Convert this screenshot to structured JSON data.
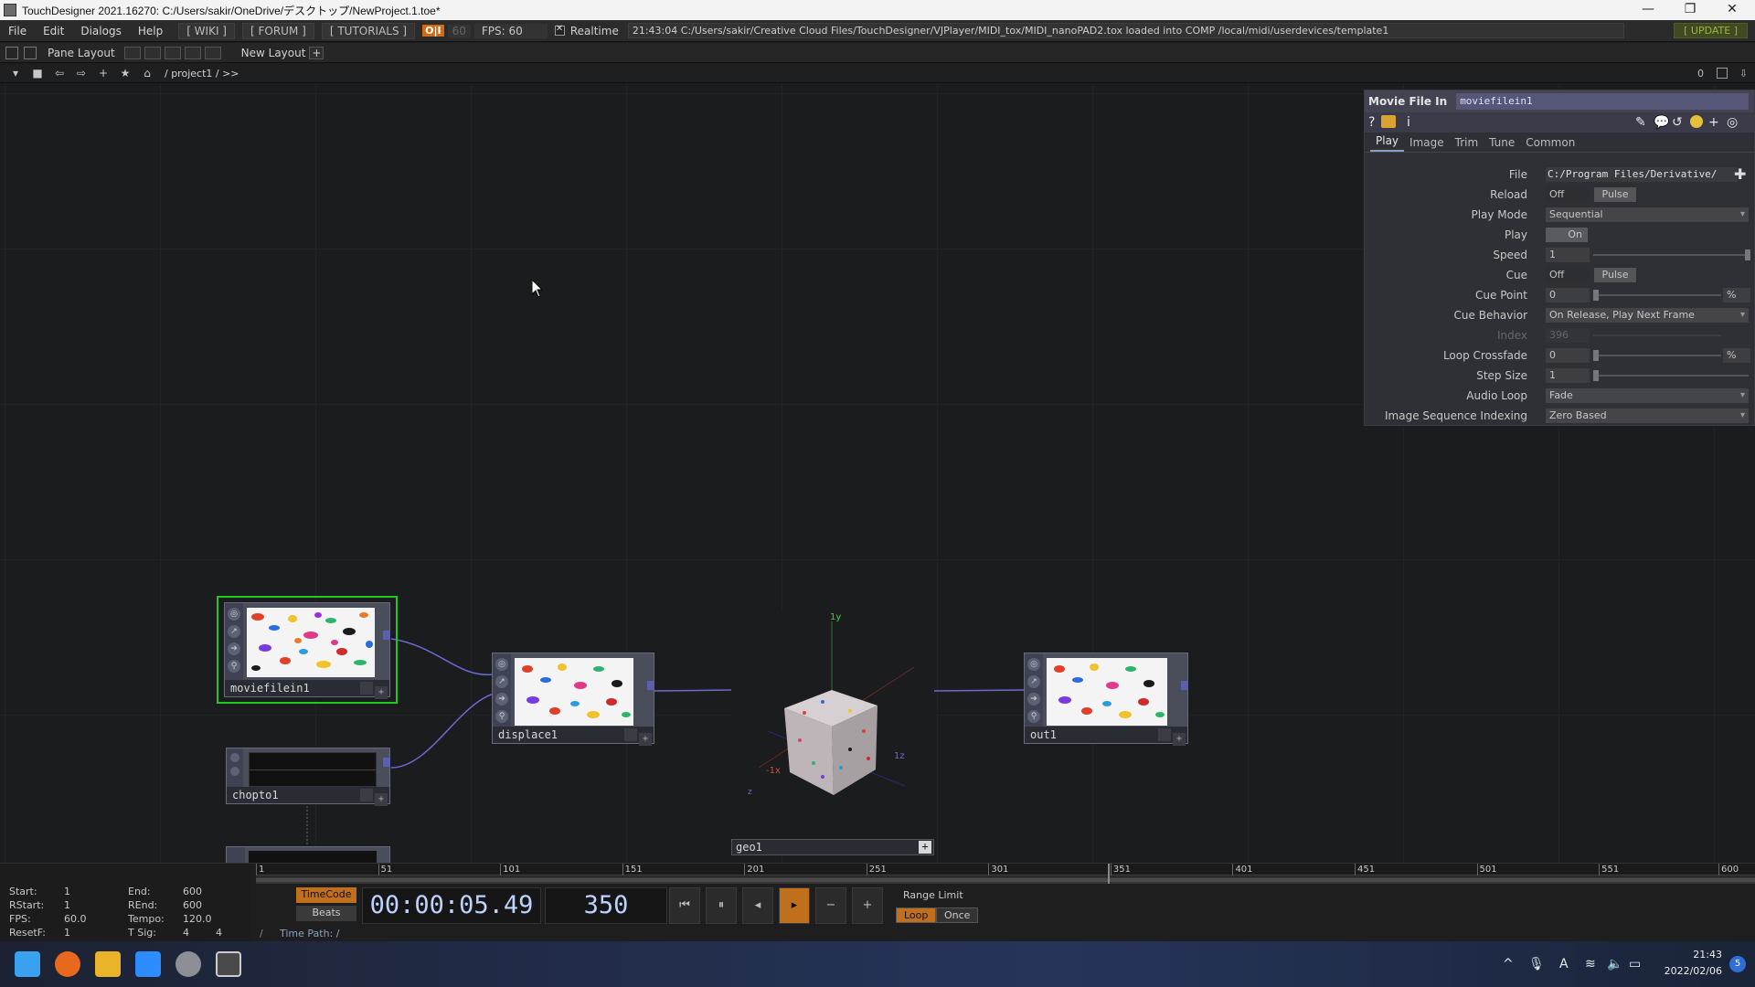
{
  "window": {
    "title": "TouchDesigner 2021.16270: C:/Users/sakir/OneDrive/デスクトップ/NewProject.1.toe*",
    "controls": {
      "minimize": "—",
      "maximize": "❐",
      "close": "✕"
    }
  },
  "menubar": {
    "items": [
      "File",
      "Edit",
      "Dialogs",
      "Help"
    ],
    "links": [
      "[ WIKI ]",
      "[ FORUM ]",
      "[ TUTORIALS ]"
    ],
    "perf_badge": "O|I",
    "fps_target": "60",
    "fps_label": "FPS:  60",
    "realtime_label": "Realtime",
    "status": "21:43:04 C:/Users/sakir/Creative Cloud Files/TouchDesigner/VJPlayer/MIDI_tox/MIDI_nanoPAD2.tox loaded into COMP /local/midi/userdevices/template1",
    "update_label": "[ UPDATE ]"
  },
  "panebar": {
    "pane_layout_label": "Pane Layout",
    "new_layout_label": "New Layout",
    "add_label": "+"
  },
  "pathbar": {
    "path": "/ project1 / >>",
    "right_value": "0"
  },
  "nodes": {
    "moviefilein": {
      "name": "moviefilein1",
      "selected": true
    },
    "displace": {
      "name": "displace1"
    },
    "geo": {
      "name": "geo1",
      "add_label": "+"
    },
    "out": {
      "name": "out1"
    },
    "chopto": {
      "name": "chopto1"
    },
    "axis_labels": {
      "y": "1y",
      "negx": "-1x",
      "z": "1z",
      "small": "z"
    }
  },
  "params": {
    "op_type": "Movie File In",
    "op_name": "moviefilein1",
    "tabs": [
      "Play",
      "Image",
      "Trim",
      "Tune",
      "Common"
    ],
    "active_tab": "Play",
    "rows": {
      "file": {
        "label": "File",
        "value": "C:/Program Files/Derivative/"
      },
      "reload": {
        "label": "Reload",
        "value": "Off",
        "pulse": "Pulse"
      },
      "play_mode": {
        "label": "Play Mode",
        "value": "Sequential"
      },
      "play": {
        "label": "Play",
        "value": "On"
      },
      "speed": {
        "label": "Speed",
        "value": "1"
      },
      "cue": {
        "label": "Cue",
        "value": "Off",
        "pulse": "Pulse"
      },
      "cue_point": {
        "label": "Cue Point",
        "value": "0",
        "unit": "%"
      },
      "cue_behavior": {
        "label": "Cue Behavior",
        "value": "On Release, Play Next Frame"
      },
      "index": {
        "label": "Index",
        "value": "396"
      },
      "loop_crossfade": {
        "label": "Loop Crossfade",
        "value": "0",
        "unit": "%"
      },
      "step_size": {
        "label": "Step Size",
        "value": "1"
      },
      "audio_loop": {
        "label": "Audio Loop",
        "value": "Fade"
      },
      "image_seq": {
        "label": "Image Sequence Indexing",
        "value": "Zero Based"
      }
    }
  },
  "timeline": {
    "ticks": [
      "1",
      "51",
      "101",
      "151",
      "201",
      "251",
      "301",
      "351",
      "401",
      "451",
      "501",
      "551",
      "600"
    ],
    "stats": {
      "start_label": "Start:",
      "start": "1",
      "end_label": "End:",
      "end": "600",
      "rstart_label": "RStart:",
      "rstart": "1",
      "rend_label": "REnd:",
      "rend": "600",
      "fps_label": "FPS:",
      "fps": "60.0",
      "tempo_label": "Tempo:",
      "tempo": "120.0",
      "resetf_label": "ResetF:",
      "resetf": "1",
      "tsig_label": "T Sig:",
      "tsig_a": "4",
      "tsig_b": "4"
    },
    "timecode_label": "TimeCode",
    "beats_label": "Beats",
    "timecode": "00:00:05.49",
    "frame": "350",
    "range_limit_label": "Range Limit",
    "loop_label": "Loop",
    "once_label": "Once",
    "time_path_label": "Time Path: /",
    "current_frame": 350,
    "frame_range": [
      1,
      600
    ]
  },
  "taskbar": {
    "clock_time": "21:43",
    "clock_date": "2022/02/06",
    "notification_count": "5",
    "ime": "A"
  },
  "colors": {
    "selected_node": "#1ec81e",
    "accent_orange": "#c0701d",
    "timecode_text": "#bcd3ff"
  }
}
